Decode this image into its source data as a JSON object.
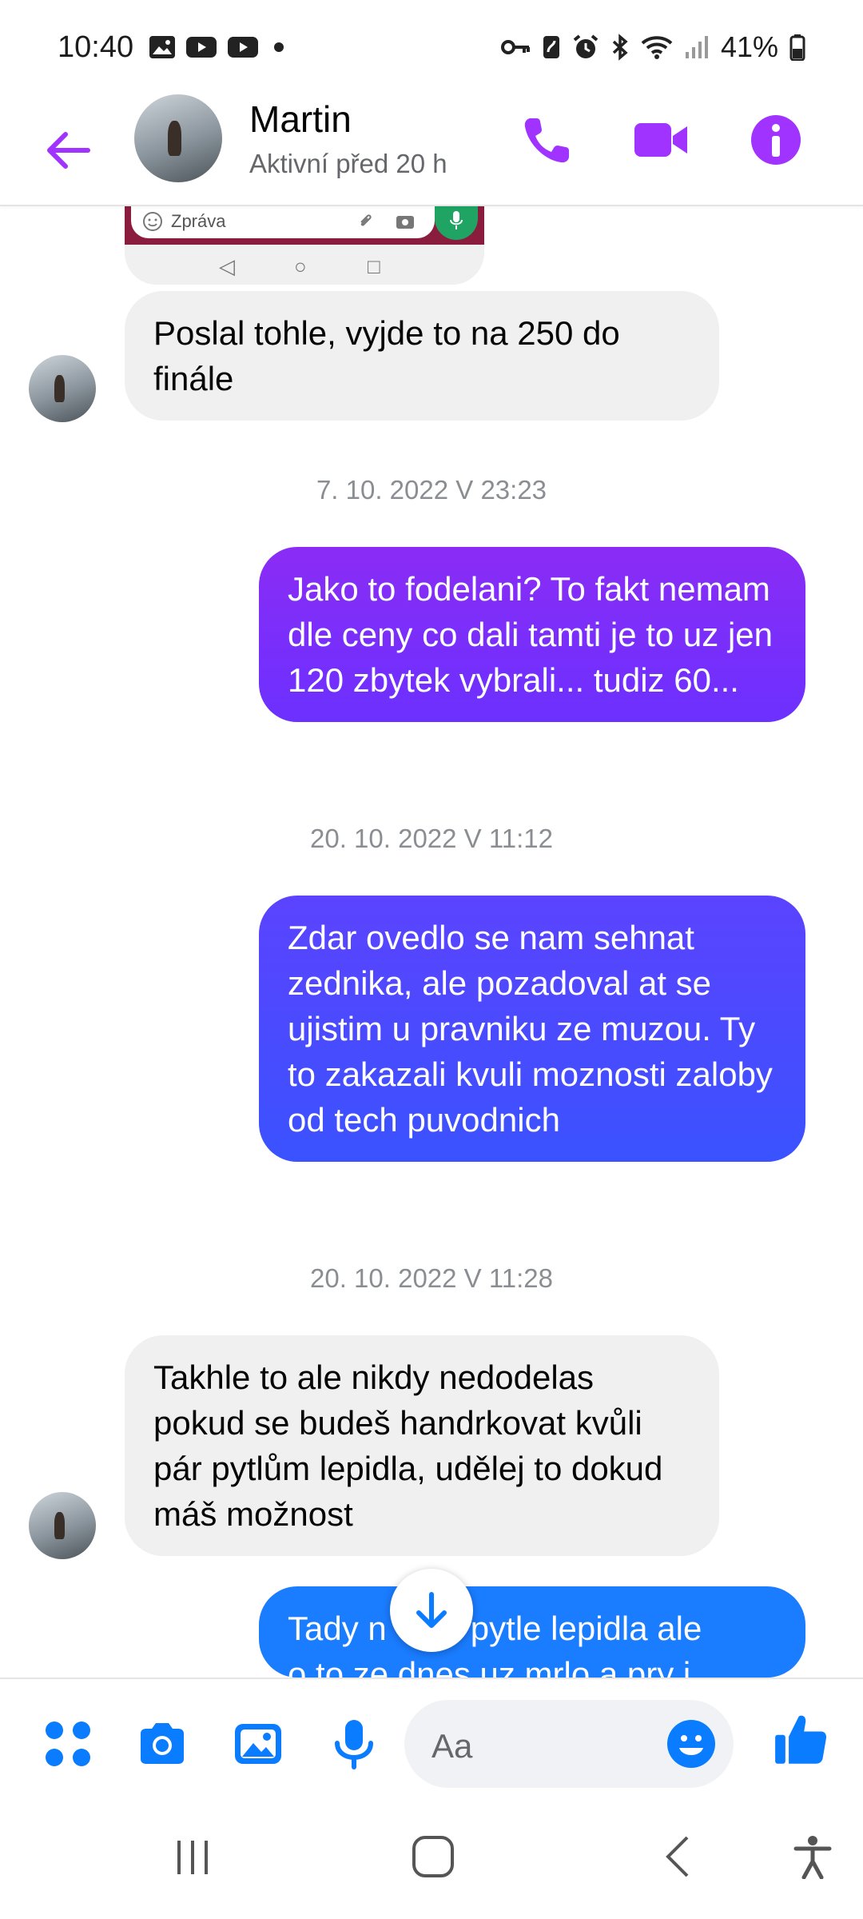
{
  "status_bar": {
    "time": "10:40",
    "battery": "41%",
    "left_icons": [
      "gallery-icon",
      "youtube-icon",
      "youtube-icon",
      "dot-icon"
    ],
    "right_icons": [
      "vpn-key-icon",
      "nfc-icon",
      "alarm-icon",
      "bluetooth-icon",
      "wifi-icon",
      "signal-icon",
      "battery-icon"
    ]
  },
  "header": {
    "contact_name": "Martin",
    "status": "Aktivní před 20 h",
    "accent": "#a033ff"
  },
  "attachment": {
    "input_placeholder": "Zpráva"
  },
  "messages": [
    {
      "type": "received",
      "text": "Poslal tohle, vyjde to na 250 do finále"
    },
    {
      "type": "timestamp",
      "text": "7. 10. 2022 V 23:23"
    },
    {
      "type": "sent",
      "text": "Jako to fodelani? To fakt nemam dle ceny co dali tamti je to uz jen 120 zbytek vybrali... tudiz 60...",
      "color": "#7d2cff"
    },
    {
      "type": "timestamp",
      "text": "20. 10. 2022 V 11:12"
    },
    {
      "type": "sent",
      "text": "Zdar ovedlo se nam sehnat zednika, ale pozadoval at se ujistim u pravniku ze muzou. Ty to zakazali kvuli moznosti zaloby od tech puvodnich",
      "color": "#4a4cff"
    },
    {
      "type": "timestamp",
      "text": "20. 10. 2022 V 11:28"
    },
    {
      "type": "received",
      "text": "Takhle to ale nikdy nedodelas pokud se budeš handrkovat kvůli pár pytlům lepidla, udělej to dokud máš možnost"
    },
    {
      "type": "sent",
      "text": "Tady n      o pytle lepidla ale",
      "text2": "o to ze dnes uz mrlo a pry i",
      "color": "#1a7cff"
    }
  ],
  "composer": {
    "placeholder": "Aa",
    "icons": [
      "apps-icon",
      "camera-icon",
      "gallery-icon",
      "microphone-icon",
      "emoji-icon",
      "thumbs-up-icon"
    ],
    "accent": "#0a7cff"
  },
  "navbar": {
    "icons": [
      "recent-apps-icon",
      "home-icon",
      "back-icon",
      "accessibility-icon"
    ]
  }
}
